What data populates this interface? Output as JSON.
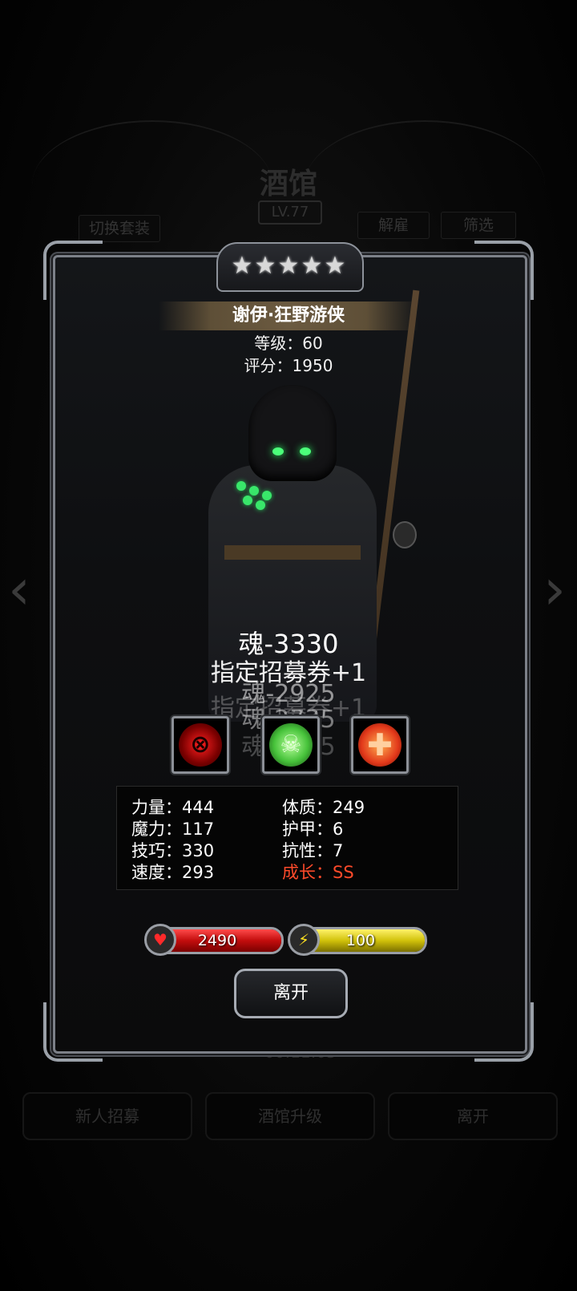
{
  "background": {
    "title": "酒馆",
    "level_badge": "LV.77",
    "btn_switch_outfit": "切换套装",
    "btn_dismiss": "解雇",
    "btn_filter": "筛选",
    "timer": "00:11:05",
    "btn_new_recruit": "新人招募",
    "btn_tavern_upgrade": "酒馆升级",
    "btn_leave_bg": "离开",
    "left_arrow": "‹",
    "right_arrow": "›"
  },
  "hero": {
    "stars": 5,
    "star_glyph": "★",
    "name": "谢伊·狂野游侠",
    "level_text": "等级：60",
    "score_text": "评分：1950"
  },
  "floating_text": {
    "line1": "魂-3330",
    "line2": "指定招募券+1",
    "line3": "魂-2925",
    "line4": "指定招募券+1",
    "line5": "魂-2735",
    "line6": "指定招募券+1",
    "line7": "魂-2025"
  },
  "skills": [
    {
      "name": "crosshair-skill-icon",
      "glyph": "⊗",
      "color": "#e01010"
    },
    {
      "name": "skull-skill-icon",
      "glyph": "☠",
      "color": "#5ad04a"
    },
    {
      "name": "medical-cross-skill-icon",
      "glyph": "✚",
      "color": "#ff6a2a"
    }
  ],
  "stats": {
    "strength": "力量：444",
    "constitution": "体质：249",
    "magic": "魔力：117",
    "armor": "护甲：6",
    "skill": "技巧：330",
    "resistance": "抗性：7",
    "speed": "速度：293",
    "growth": "成长：SS"
  },
  "bars": {
    "hp_value": "2490",
    "hp_fill": 1.0,
    "energy_value": "100",
    "energy_fill": 1.0,
    "hp_icon": "heart-icon",
    "energy_icon": "lightning-icon"
  },
  "actions": {
    "leave_label": "离开"
  },
  "colors": {
    "growth": "#ff4a2a",
    "hp": "#d01010",
    "energy": "#e2d21a",
    "eyes": "#4bff7a"
  }
}
